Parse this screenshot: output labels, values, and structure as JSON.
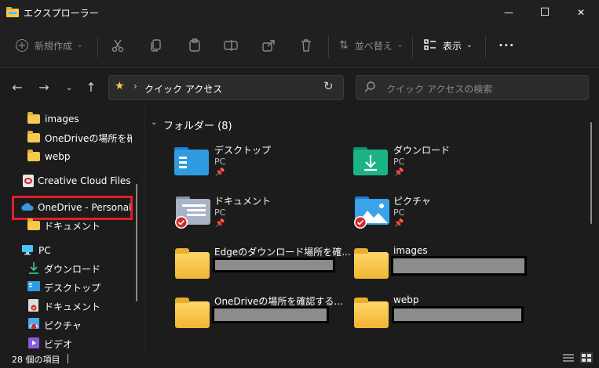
{
  "window": {
    "title": "エクスプローラー",
    "minimize_glyph": "—",
    "maximize_glyph": "☐",
    "close_glyph": "✕"
  },
  "toolbar": {
    "new_label": "新規作成",
    "sort_label": "並べ替え",
    "view_label": "表示",
    "more_glyph": "•••"
  },
  "address": {
    "path_label": "クイック アクセス",
    "search_placeholder": "クイック アクセスの検索"
  },
  "sidebar": {
    "items": [
      {
        "label": "images"
      },
      {
        "label": "OneDriveの場所を確認"
      },
      {
        "label": "webp"
      },
      {
        "label": "Creative Cloud Files"
      },
      {
        "label": "OneDrive - Personal"
      },
      {
        "label": "ドキュメント"
      },
      {
        "label": "PC"
      },
      {
        "label": "ダウンロード"
      },
      {
        "label": "デスクトップ"
      },
      {
        "label": "ドキュメント"
      },
      {
        "label": "ピクチャ"
      },
      {
        "label": "ビデオ"
      }
    ]
  },
  "main": {
    "section_title": "フォルダー (8)",
    "tiles": [
      {
        "name": "デスクトップ",
        "sub": "PC",
        "pinned": true
      },
      {
        "name": "ダウンロード",
        "sub": "PC",
        "pinned": true
      },
      {
        "name": "ドキュメント",
        "sub": "PC",
        "pinned": true
      },
      {
        "name": "ピクチャ",
        "sub": "PC",
        "pinned": true
      },
      {
        "name": "Edgeのダウンロード場所を確...",
        "sub": ""
      },
      {
        "name": "images",
        "sub": ""
      },
      {
        "name": "OneDriveの場所を確認する...",
        "sub": ""
      },
      {
        "name": "webp",
        "sub": ""
      }
    ]
  },
  "status": {
    "item_count": "28 個の項目"
  },
  "colors": {
    "accent": "#4cc2ff",
    "highlight_border": "#e0202a",
    "folder_yellow": "#f5c94a"
  }
}
